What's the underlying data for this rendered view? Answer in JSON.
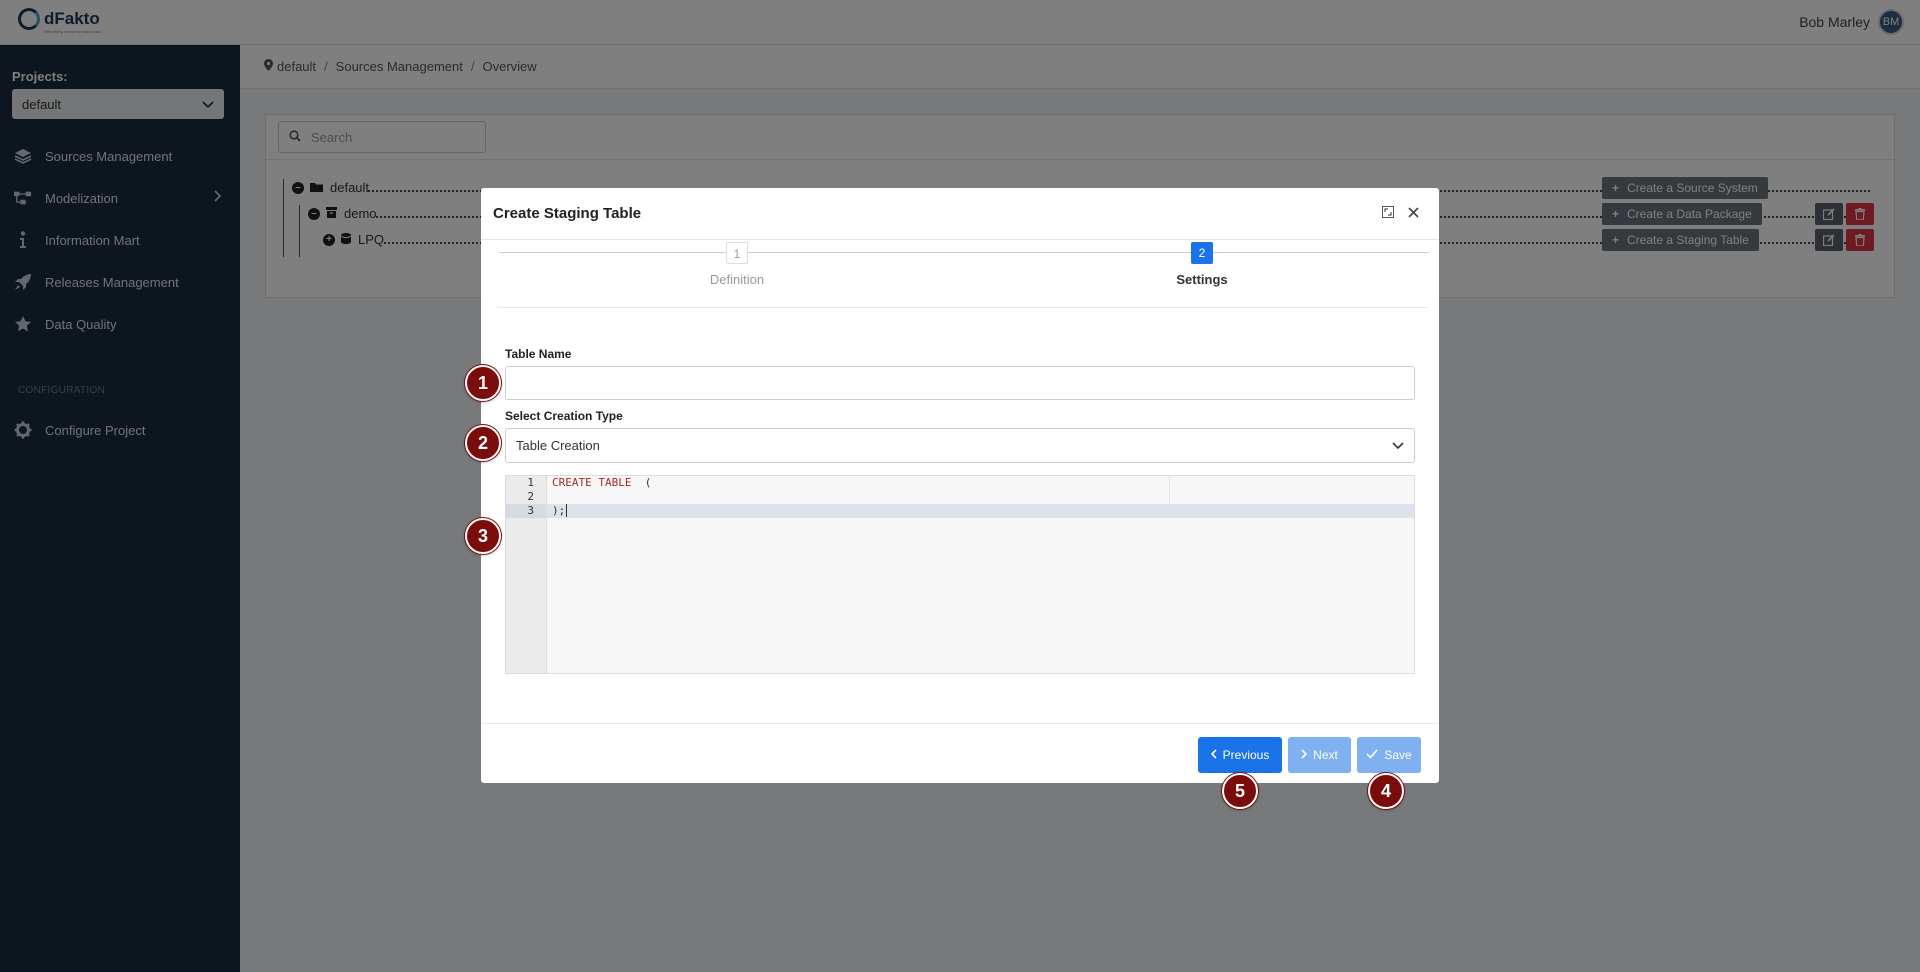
{
  "app": {
    "logo_text": "dFakto",
    "logo_tagline": "Rebuilding enterprise data stack",
    "user_name": "Bob Marley",
    "user_initials": "BM"
  },
  "sidebar": {
    "projects_label": "Projects:",
    "project_selected": "default",
    "items": [
      {
        "label": "Sources Management",
        "icon": "layers-icon"
      },
      {
        "label": "Modelization",
        "icon": "diagram-icon"
      },
      {
        "label": "Information Mart",
        "icon": "info-icon"
      },
      {
        "label": "Releases Management",
        "icon": "rocket-icon"
      },
      {
        "label": "Data Quality",
        "icon": "star-icon"
      }
    ],
    "config_label": "CONFIGURATION",
    "config_item": {
      "label": "Configure Project",
      "icon": "gear-icon"
    }
  },
  "breadcrumb": [
    "default",
    "Sources Management",
    "Overview"
  ],
  "panel": {
    "search_placeholder": "Search",
    "tree": [
      {
        "label": "default"
      },
      {
        "label": "demo"
      },
      {
        "label": "LPQ"
      }
    ],
    "actions": [
      "Create a Source System",
      "Create a Data Package",
      "Create a Staging Table"
    ]
  },
  "modal": {
    "title": "Create Staging Table",
    "steps": [
      {
        "num": "1",
        "label": "Definition"
      },
      {
        "num": "2",
        "label": "Settings"
      }
    ],
    "table_name_label": "Table Name",
    "table_name_value": "",
    "creation_type_label": "Select Creation Type",
    "creation_type_value": "Table Creation",
    "editor": {
      "line_numbers": [
        "1",
        "2",
        "3"
      ],
      "lines": [
        "CREATE TABLE  (",
        "",
        ");"
      ]
    },
    "buttons": {
      "previous": "Previous",
      "next": "Next",
      "save": "Save"
    }
  },
  "badges": [
    "1",
    "2",
    "3",
    "4",
    "5"
  ],
  "colors": {
    "primary": "#1a73e8",
    "sidebar": "#1b2d3e",
    "badge": "#7a0c0c",
    "danger": "#dc3545"
  }
}
